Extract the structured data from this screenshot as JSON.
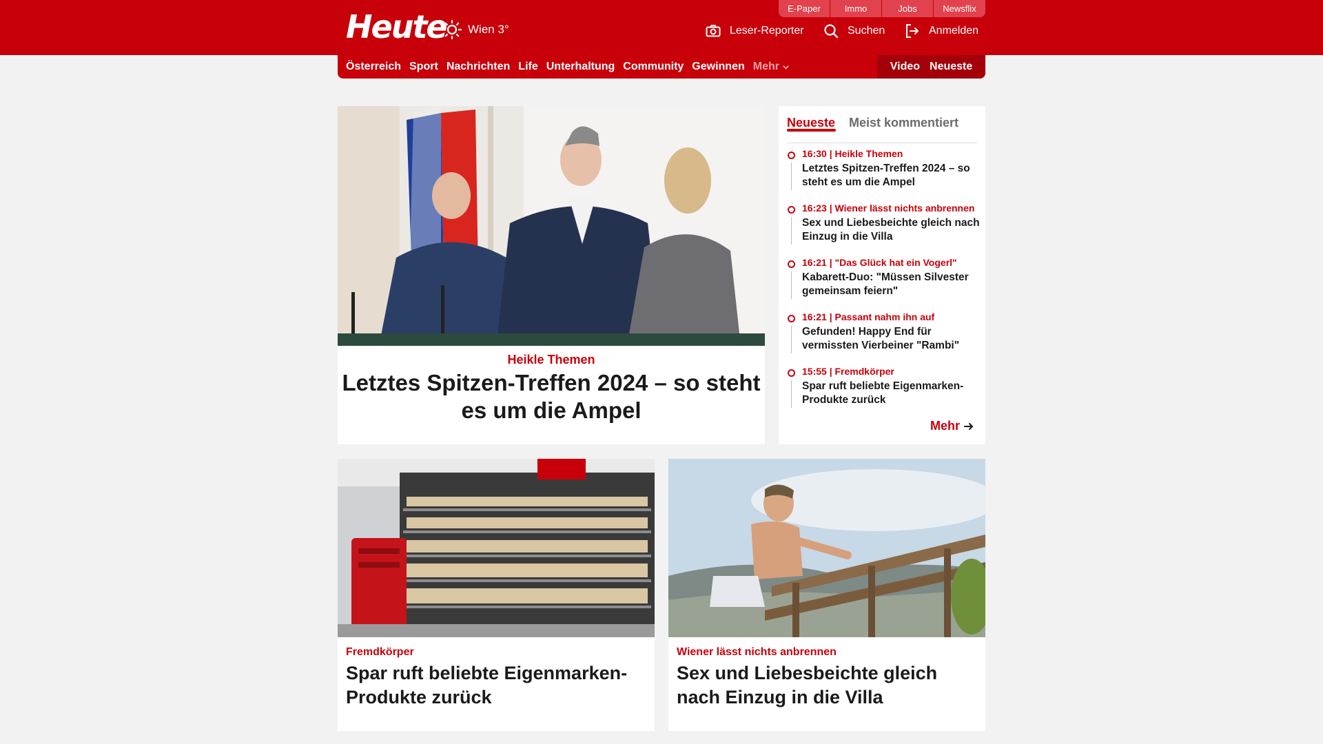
{
  "header": {
    "logo": "Heute",
    "weather": {
      "icon": "sun-icon",
      "text": "Wien 3°"
    },
    "quicklinks": [
      "E-Paper",
      "Immo",
      "Jobs",
      "Newsflix"
    ],
    "actions": {
      "reporter": "Leser-Reporter",
      "search": "Suchen",
      "login": "Anmelden"
    },
    "brand_color": "#c8000a"
  },
  "nav": {
    "items": [
      "Österreich",
      "Sport",
      "Nachrichten",
      "Life",
      "Unterhaltung",
      "Community",
      "Gewinnen"
    ],
    "more": "Mehr",
    "right": [
      "Video",
      "Neueste"
    ]
  },
  "hero": {
    "kicker": "Heikle Themen",
    "title": "Letztes Spitzen-Treffen 2024 – so steht es um die Ampel"
  },
  "sidebar": {
    "tabs": [
      "Neueste",
      "Meist kommentiert"
    ],
    "items": [
      {
        "meta": "16:30 | Heikle Themen",
        "title": "Letztes Spitzen-Treffen 2024 – so steht es um die Ampel"
      },
      {
        "meta": "16:23 | Wiener lässt nichts anbrennen",
        "title": "Sex und Liebesbeichte gleich nach Einzug in die Villa"
      },
      {
        "meta": "16:21 | \"Das Glück hat ein Vogerl\"",
        "title": "Kabarett-Duo: \"Müssen Silvester gemeinsam feiern\""
      },
      {
        "meta": "16:21 | Passant nahm ihn auf",
        "title": "Gefunden! Happy End für vermissten Vierbeiner \"Rambi\""
      },
      {
        "meta": "15:55 | Fremdkörper",
        "title": "Spar ruft beliebte Eigenmarken-Produkte zurück"
      }
    ],
    "more": "Mehr"
  },
  "cards": [
    {
      "kicker": "Fremdkörper",
      "title": "Spar ruft beliebte Eigenmarken-Produkte zurück"
    },
    {
      "kicker": "Wiener lässt nichts anbrennen",
      "title": "Sex und Liebesbeichte gleich nach Einzug in die Villa"
    }
  ]
}
